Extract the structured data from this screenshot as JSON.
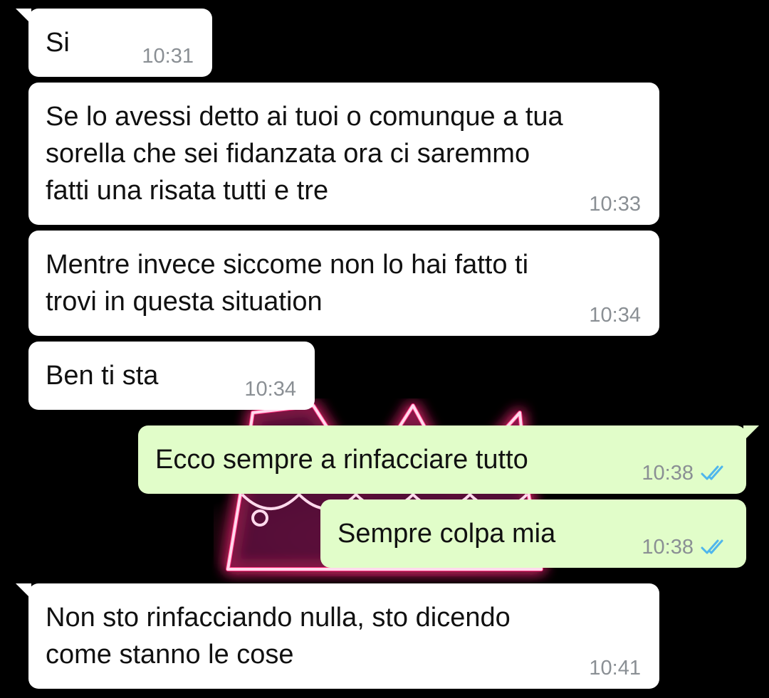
{
  "conversation": {
    "messages": [
      {
        "direction": "incoming",
        "text": "Si",
        "time": "10:31",
        "status_icon": ""
      },
      {
        "direction": "incoming",
        "text": "Se lo avessi detto ai tuoi o comunque a tua\nsorella che sei fidanzata ora ci saremmo\nfatti una risata tutti e tre",
        "time": "10:33",
        "status_icon": ""
      },
      {
        "direction": "incoming",
        "text": "Mentre invece siccome non lo hai fatto ti\ntrovi in questa situation",
        "time": "10:34",
        "status_icon": ""
      },
      {
        "direction": "incoming",
        "text": "Ben ti sta",
        "time": "10:34",
        "status_icon": ""
      },
      {
        "direction": "outgoing",
        "text": "Ecco sempre a rinfacciare tutto",
        "time": "10:38",
        "status_icon": "double-check-icon"
      },
      {
        "direction": "outgoing",
        "text": "Sempre colpa mia",
        "time": "10:38",
        "status_icon": "double-check-icon"
      },
      {
        "direction": "incoming",
        "text": "Non sto rinfacciando nulla, sto dicendo\ncome stanno le cose",
        "time": "10:41",
        "status_icon": ""
      }
    ]
  },
  "theme": {
    "background": "#000000",
    "incoming_bubble": "#ffffff",
    "outgoing_bubble": "#e1fdc9",
    "time_color": "#8a8f94",
    "read_tick_color": "#4fb6ec",
    "wallpaper_neon": "#ff2d7a"
  },
  "wallpaper": {
    "icon": "neon-crown-icon"
  }
}
